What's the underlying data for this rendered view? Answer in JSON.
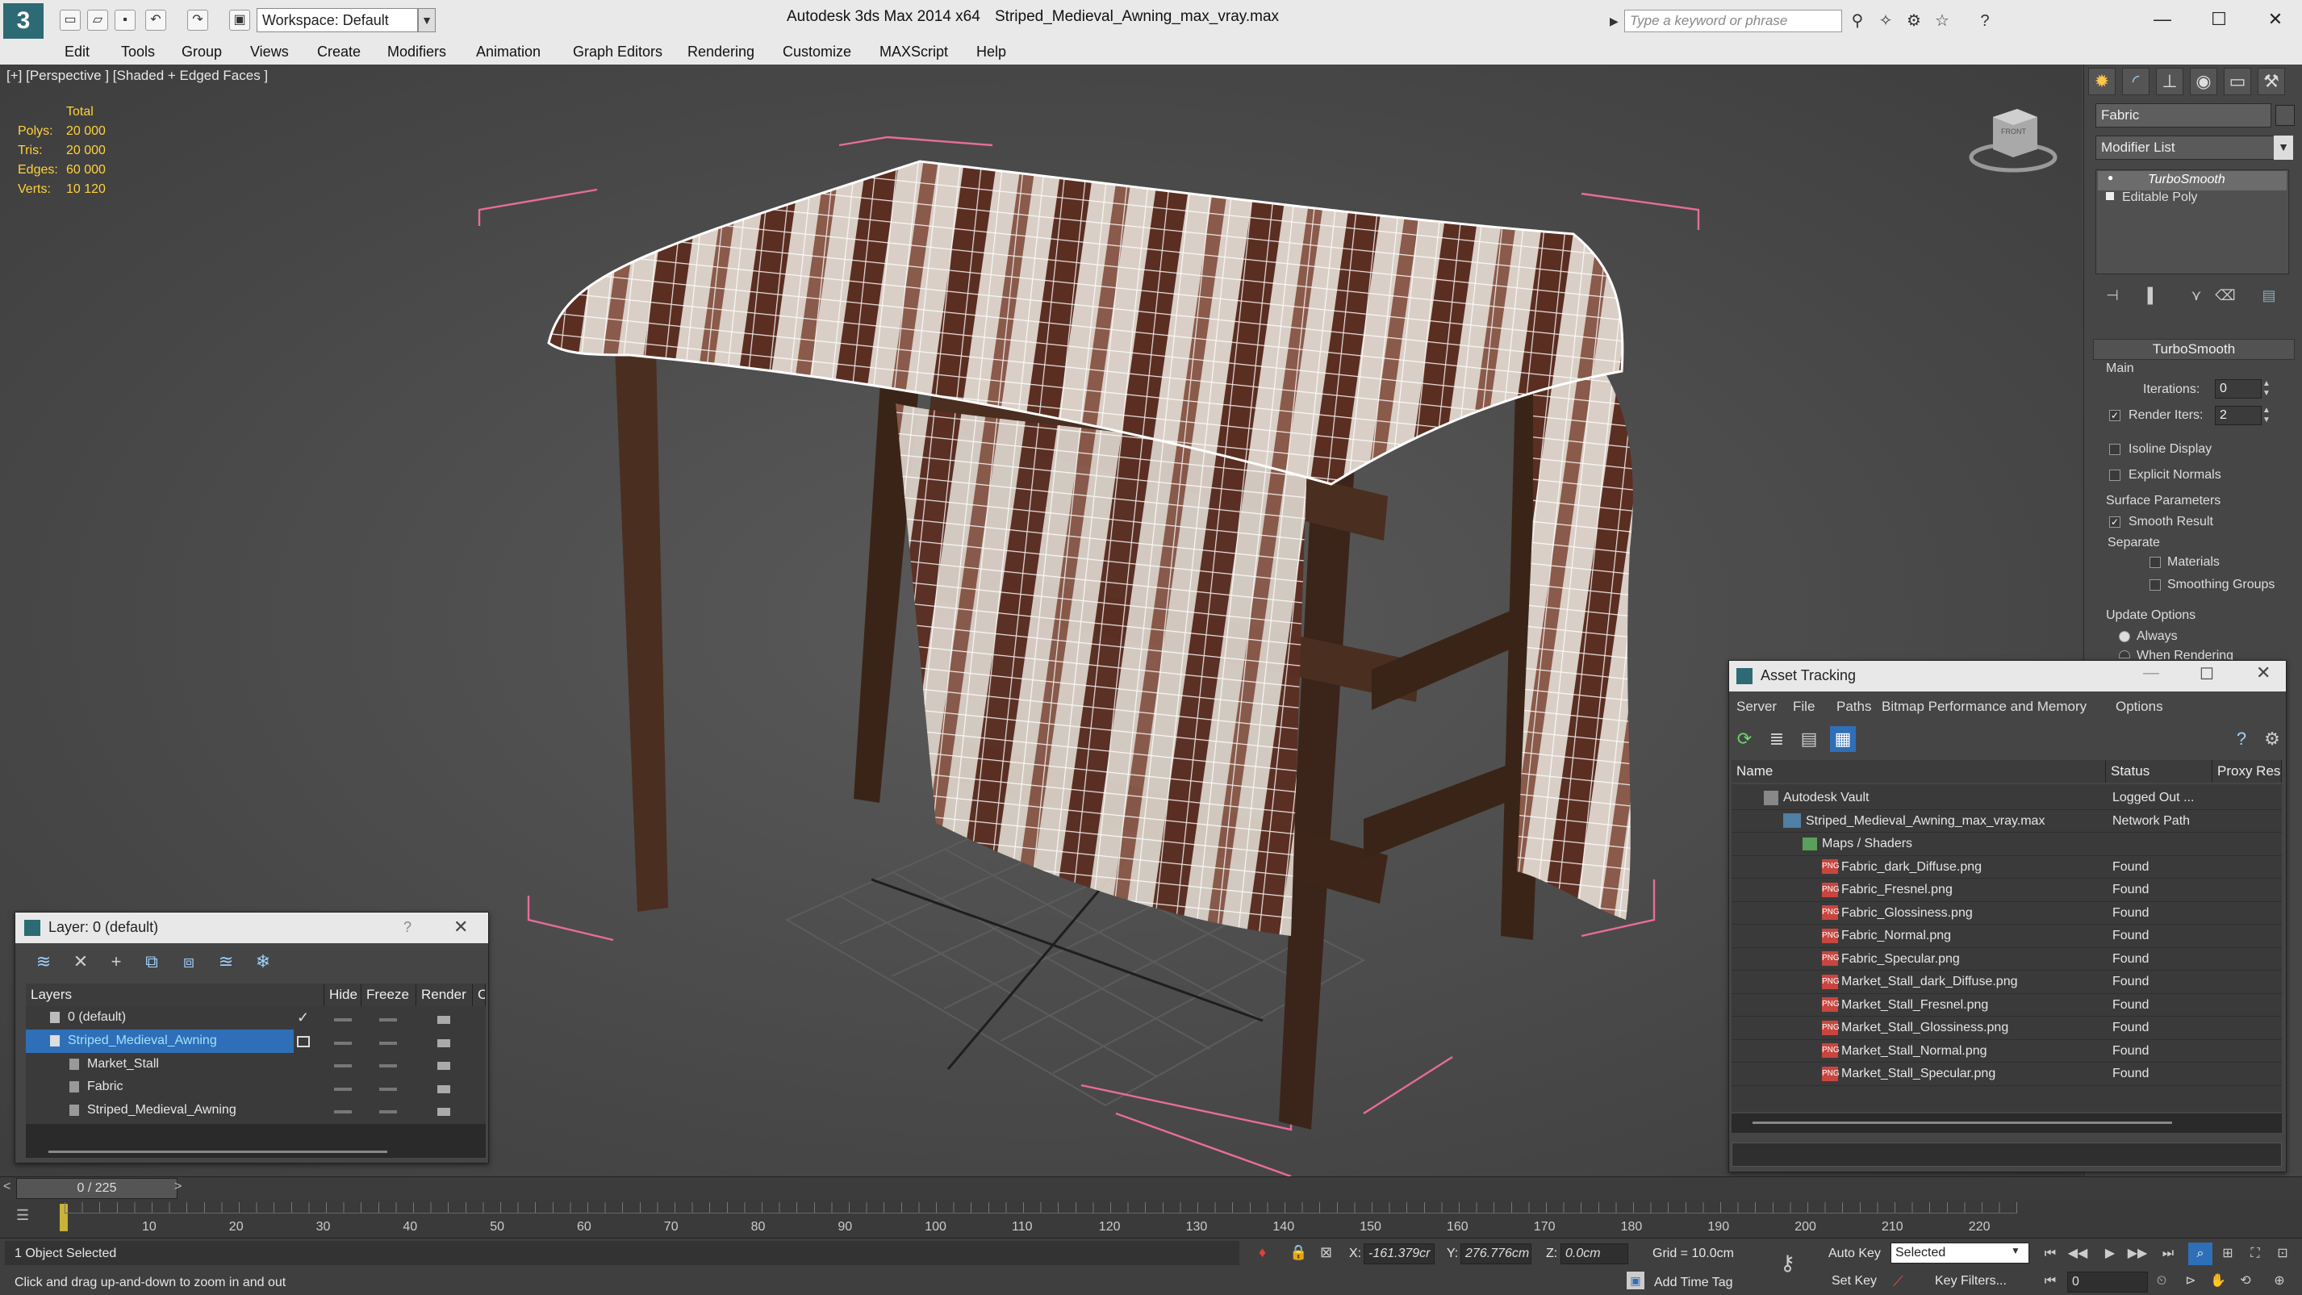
{
  "app": {
    "title": "Autodesk 3ds Max  2014 x64",
    "file": "Striped_Medieval_Awning_max_vray.max",
    "workspace": "Workspace: Default",
    "search_placeholder": "Type a keyword or phrase"
  },
  "menu": [
    "Edit",
    "Tools",
    "Group",
    "Views",
    "Create",
    "Modifiers",
    "Animation",
    "Graph Editors",
    "Rendering",
    "Customize",
    "MAXScript",
    "Help"
  ],
  "viewport": {
    "label": "[+] [Perspective ] [Shaded + Edged Faces ]",
    "stats": {
      "header": "Total",
      "rows": [
        {
          "label": "Polys:",
          "value": "20 000"
        },
        {
          "label": "Tris:",
          "value": "20 000"
        },
        {
          "label": "Edges:",
          "value": "60 000"
        },
        {
          "label": "Verts:",
          "value": "10 120"
        }
      ]
    },
    "viewcube_label": "FRONT"
  },
  "command_panel": {
    "object_name": "Fabric",
    "modifier_list": "Modifier List",
    "stack": [
      "TurboSmooth",
      "Editable Poly"
    ],
    "rollout_title": "TurboSmooth",
    "main_label": "Main",
    "iterations_label": "Iterations:",
    "iterations_value": "0",
    "render_iters_label": "Render Iters:",
    "render_iters_value": "2",
    "isoline": "Isoline Display",
    "explicit": "Explicit Normals",
    "surface_params": "Surface Parameters",
    "smooth_result": "Smooth Result",
    "separate": "Separate",
    "materials": "Materials",
    "smoothing_groups": "Smoothing Groups",
    "update_options": "Update Options",
    "always": "Always",
    "when_rendering": "When Rendering"
  },
  "layer_panel": {
    "title": "Layer: 0 (default)",
    "help": "?",
    "columns": [
      "Layers",
      "Hide",
      "Freeze",
      "Render",
      "C"
    ],
    "rows": [
      {
        "name": "0 (default)",
        "level": 0,
        "selected": false
      },
      {
        "name": "Striped_Medieval_Awning",
        "level": 0,
        "selected": true
      },
      {
        "name": "Market_Stall",
        "level": 1,
        "selected": false
      },
      {
        "name": "Fabric",
        "level": 1,
        "selected": false
      },
      {
        "name": "Striped_Medieval_Awning",
        "level": 1,
        "selected": false
      }
    ]
  },
  "asset_panel": {
    "title": "Asset Tracking",
    "menu": [
      "Server",
      "File",
      "Paths",
      "Bitmap Performance and Memory",
      "Options"
    ],
    "columns": [
      "Name",
      "Status",
      "Proxy Reso"
    ],
    "rows": [
      {
        "name": "Autodesk Vault",
        "status": "Logged Out ...",
        "type": "vault",
        "level": 0
      },
      {
        "name": "Striped_Medieval_Awning_max_vray.max",
        "status": "Network Path",
        "type": "max",
        "level": 1
      },
      {
        "name": "Maps / Shaders",
        "status": "",
        "type": "folder",
        "level": 2
      },
      {
        "name": "Fabric_dark_Diffuse.png",
        "status": "Found",
        "type": "png",
        "level": 3
      },
      {
        "name": "Fabric_Fresnel.png",
        "status": "Found",
        "type": "png",
        "level": 3
      },
      {
        "name": "Fabric_Glossiness.png",
        "status": "Found",
        "type": "png",
        "level": 3
      },
      {
        "name": "Fabric_Normal.png",
        "status": "Found",
        "type": "png",
        "level": 3
      },
      {
        "name": "Fabric_Specular.png",
        "status": "Found",
        "type": "png",
        "level": 3
      },
      {
        "name": "Market_Stall_dark_Diffuse.png",
        "status": "Found",
        "type": "png",
        "level": 3
      },
      {
        "name": "Market_Stall_Fresnel.png",
        "status": "Found",
        "type": "png",
        "level": 3
      },
      {
        "name": "Market_Stall_Glossiness.png",
        "status": "Found",
        "type": "png",
        "level": 3
      },
      {
        "name": "Market_Stall_Normal.png",
        "status": "Found",
        "type": "png",
        "level": 3
      },
      {
        "name": "Market_Stall_Specular.png",
        "status": "Found",
        "type": "png",
        "level": 3
      }
    ]
  },
  "timeline": {
    "frame": "0 / 225",
    "ticks": [
      "10",
      "20",
      "30",
      "40",
      "50",
      "60",
      "70",
      "80",
      "90",
      "100",
      "110",
      "120",
      "130",
      "140",
      "150",
      "160",
      "170",
      "180",
      "190",
      "200",
      "210",
      "220"
    ]
  },
  "status": {
    "selected": "1 Object Selected",
    "hint": "Click and drag up-and-down to zoom in and out",
    "x_label": "X:",
    "x_value": "-161.379cr",
    "y_label": "Y:",
    "y_value": "276.776cm",
    "z_label": "Z:",
    "z_value": "0.0cm",
    "grid": "Grid = 10.0cm",
    "auto_key": "Auto Key",
    "set_key": "Set Key",
    "selected_dropdown": "Selected",
    "key_filters": "Key Filters...",
    "add_time_tag": "Add Time Tag",
    "frame_value": "0"
  }
}
